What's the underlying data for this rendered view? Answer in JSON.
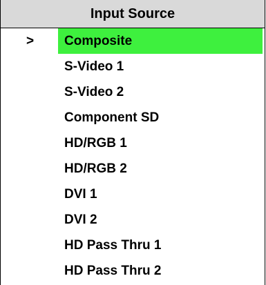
{
  "menu": {
    "title": "Input Source",
    "selection_marker": ">",
    "selected_index": 0,
    "highlight_color": "#3ef03e",
    "header_color": "#d9d9d9",
    "items": [
      {
        "label": "Composite"
      },
      {
        "label": "S-Video 1"
      },
      {
        "label": "S-Video 2"
      },
      {
        "label": "Component SD"
      },
      {
        "label": "HD/RGB 1"
      },
      {
        "label": "HD/RGB 2"
      },
      {
        "label": "DVI 1"
      },
      {
        "label": "DVI 2"
      },
      {
        "label": "HD Pass Thru 1"
      },
      {
        "label": "HD Pass Thru 2"
      }
    ]
  }
}
